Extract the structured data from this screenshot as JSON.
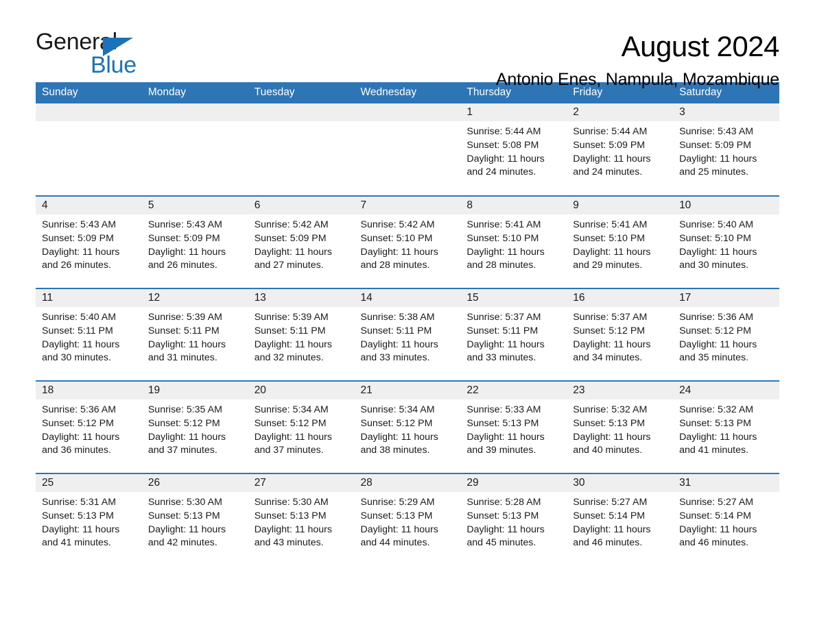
{
  "brand": {
    "name_part1": "General",
    "name_part2": "Blue",
    "accent_color": "#1b72b8"
  },
  "header": {
    "title": "August 2024",
    "location": "Antonio Enes, Nampula, Mozambique"
  },
  "theme": {
    "header_blue": "#2e75b6",
    "daynum_gray": "#efefef"
  },
  "calendar": {
    "weekday_headers": [
      "Sunday",
      "Monday",
      "Tuesday",
      "Wednesday",
      "Thursday",
      "Friday",
      "Saturday"
    ],
    "weeks": [
      [
        {
          "day": "",
          "sunrise": "",
          "sunset": "",
          "daylight": "",
          "empty": true
        },
        {
          "day": "",
          "sunrise": "",
          "sunset": "",
          "daylight": "",
          "empty": true
        },
        {
          "day": "",
          "sunrise": "",
          "sunset": "",
          "daylight": "",
          "empty": true
        },
        {
          "day": "",
          "sunrise": "",
          "sunset": "",
          "daylight": "",
          "empty": true
        },
        {
          "day": "1",
          "sunrise": "Sunrise: 5:44 AM",
          "sunset": "Sunset: 5:08 PM",
          "daylight": "Daylight: 11 hours and 24 minutes."
        },
        {
          "day": "2",
          "sunrise": "Sunrise: 5:44 AM",
          "sunset": "Sunset: 5:09 PM",
          "daylight": "Daylight: 11 hours and 24 minutes."
        },
        {
          "day": "3",
          "sunrise": "Sunrise: 5:43 AM",
          "sunset": "Sunset: 5:09 PM",
          "daylight": "Daylight: 11 hours and 25 minutes."
        }
      ],
      [
        {
          "day": "4",
          "sunrise": "Sunrise: 5:43 AM",
          "sunset": "Sunset: 5:09 PM",
          "daylight": "Daylight: 11 hours and 26 minutes."
        },
        {
          "day": "5",
          "sunrise": "Sunrise: 5:43 AM",
          "sunset": "Sunset: 5:09 PM",
          "daylight": "Daylight: 11 hours and 26 minutes."
        },
        {
          "day": "6",
          "sunrise": "Sunrise: 5:42 AM",
          "sunset": "Sunset: 5:09 PM",
          "daylight": "Daylight: 11 hours and 27 minutes."
        },
        {
          "day": "7",
          "sunrise": "Sunrise: 5:42 AM",
          "sunset": "Sunset: 5:10 PM",
          "daylight": "Daylight: 11 hours and 28 minutes."
        },
        {
          "day": "8",
          "sunrise": "Sunrise: 5:41 AM",
          "sunset": "Sunset: 5:10 PM",
          "daylight": "Daylight: 11 hours and 28 minutes."
        },
        {
          "day": "9",
          "sunrise": "Sunrise: 5:41 AM",
          "sunset": "Sunset: 5:10 PM",
          "daylight": "Daylight: 11 hours and 29 minutes."
        },
        {
          "day": "10",
          "sunrise": "Sunrise: 5:40 AM",
          "sunset": "Sunset: 5:10 PM",
          "daylight": "Daylight: 11 hours and 30 minutes."
        }
      ],
      [
        {
          "day": "11",
          "sunrise": "Sunrise: 5:40 AM",
          "sunset": "Sunset: 5:11 PM",
          "daylight": "Daylight: 11 hours and 30 minutes."
        },
        {
          "day": "12",
          "sunrise": "Sunrise: 5:39 AM",
          "sunset": "Sunset: 5:11 PM",
          "daylight": "Daylight: 11 hours and 31 minutes."
        },
        {
          "day": "13",
          "sunrise": "Sunrise: 5:39 AM",
          "sunset": "Sunset: 5:11 PM",
          "daylight": "Daylight: 11 hours and 32 minutes."
        },
        {
          "day": "14",
          "sunrise": "Sunrise: 5:38 AM",
          "sunset": "Sunset: 5:11 PM",
          "daylight": "Daylight: 11 hours and 33 minutes."
        },
        {
          "day": "15",
          "sunrise": "Sunrise: 5:37 AM",
          "sunset": "Sunset: 5:11 PM",
          "daylight": "Daylight: 11 hours and 33 minutes."
        },
        {
          "day": "16",
          "sunrise": "Sunrise: 5:37 AM",
          "sunset": "Sunset: 5:12 PM",
          "daylight": "Daylight: 11 hours and 34 minutes."
        },
        {
          "day": "17",
          "sunrise": "Sunrise: 5:36 AM",
          "sunset": "Sunset: 5:12 PM",
          "daylight": "Daylight: 11 hours and 35 minutes."
        }
      ],
      [
        {
          "day": "18",
          "sunrise": "Sunrise: 5:36 AM",
          "sunset": "Sunset: 5:12 PM",
          "daylight": "Daylight: 11 hours and 36 minutes."
        },
        {
          "day": "19",
          "sunrise": "Sunrise: 5:35 AM",
          "sunset": "Sunset: 5:12 PM",
          "daylight": "Daylight: 11 hours and 37 minutes."
        },
        {
          "day": "20",
          "sunrise": "Sunrise: 5:34 AM",
          "sunset": "Sunset: 5:12 PM",
          "daylight": "Daylight: 11 hours and 37 minutes."
        },
        {
          "day": "21",
          "sunrise": "Sunrise: 5:34 AM",
          "sunset": "Sunset: 5:12 PM",
          "daylight": "Daylight: 11 hours and 38 minutes."
        },
        {
          "day": "22",
          "sunrise": "Sunrise: 5:33 AM",
          "sunset": "Sunset: 5:13 PM",
          "daylight": "Daylight: 11 hours and 39 minutes."
        },
        {
          "day": "23",
          "sunrise": "Sunrise: 5:32 AM",
          "sunset": "Sunset: 5:13 PM",
          "daylight": "Daylight: 11 hours and 40 minutes."
        },
        {
          "day": "24",
          "sunrise": "Sunrise: 5:32 AM",
          "sunset": "Sunset: 5:13 PM",
          "daylight": "Daylight: 11 hours and 41 minutes."
        }
      ],
      [
        {
          "day": "25",
          "sunrise": "Sunrise: 5:31 AM",
          "sunset": "Sunset: 5:13 PM",
          "daylight": "Daylight: 11 hours and 41 minutes."
        },
        {
          "day": "26",
          "sunrise": "Sunrise: 5:30 AM",
          "sunset": "Sunset: 5:13 PM",
          "daylight": "Daylight: 11 hours and 42 minutes."
        },
        {
          "day": "27",
          "sunrise": "Sunrise: 5:30 AM",
          "sunset": "Sunset: 5:13 PM",
          "daylight": "Daylight: 11 hours and 43 minutes."
        },
        {
          "day": "28",
          "sunrise": "Sunrise: 5:29 AM",
          "sunset": "Sunset: 5:13 PM",
          "daylight": "Daylight: 11 hours and 44 minutes."
        },
        {
          "day": "29",
          "sunrise": "Sunrise: 5:28 AM",
          "sunset": "Sunset: 5:13 PM",
          "daylight": "Daylight: 11 hours and 45 minutes."
        },
        {
          "day": "30",
          "sunrise": "Sunrise: 5:27 AM",
          "sunset": "Sunset: 5:14 PM",
          "daylight": "Daylight: 11 hours and 46 minutes."
        },
        {
          "day": "31",
          "sunrise": "Sunrise: 5:27 AM",
          "sunset": "Sunset: 5:14 PM",
          "daylight": "Daylight: 11 hours and 46 minutes."
        }
      ]
    ]
  }
}
